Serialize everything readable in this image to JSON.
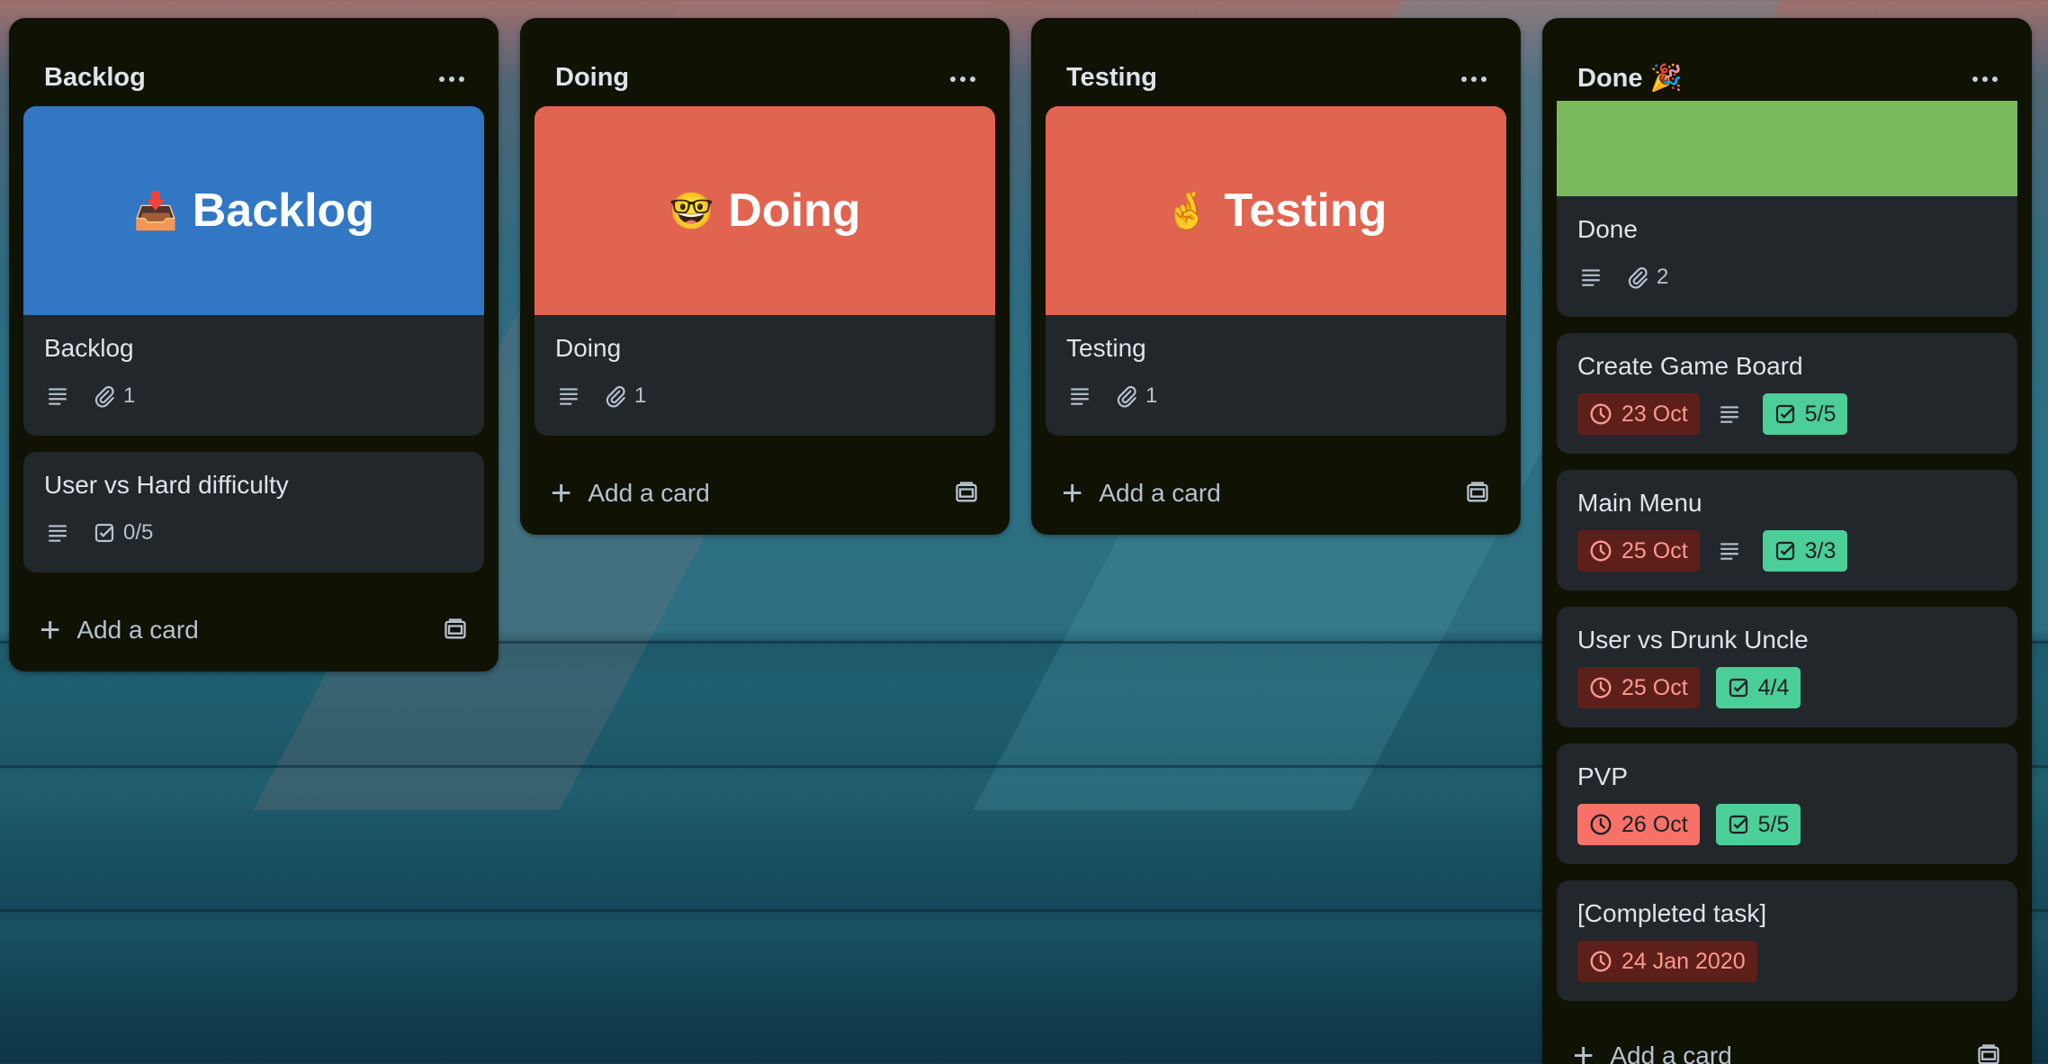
{
  "colors": {
    "list_bg": "#101204",
    "card_bg": "#22272b",
    "cover_blue": "#3177c3",
    "cover_red": "#e06450",
    "cover_green": "#7aba5c",
    "due_red": "#5d1f1a",
    "due_red_strong": "#f87168",
    "checklist_green": "#4bce97"
  },
  "add_card_label": "Add a card",
  "lists": [
    {
      "title": "Backlog",
      "cards": [
        {
          "cover_text": "Backlog",
          "cover_emoji": "📥",
          "title": "Backlog",
          "icons": [
            "description-icon",
            "paperclip-icon"
          ],
          "attachments": "1"
        },
        {
          "title": "User vs Hard difficulty",
          "icons": [
            "description-icon",
            "checklist-icon"
          ],
          "checklist": "0/5"
        }
      ]
    },
    {
      "title": "Doing",
      "cards": [
        {
          "cover_text": "Doing",
          "cover_emoji": "🤓",
          "title": "Doing",
          "icons": [
            "description-icon",
            "paperclip-icon"
          ],
          "attachments": "1"
        }
      ]
    },
    {
      "title": "Testing",
      "cards": [
        {
          "cover_text": "Testing",
          "cover_emoji": "🤞",
          "title": "Testing",
          "icons": [
            "description-icon",
            "paperclip-icon"
          ],
          "attachments": "1"
        }
      ]
    },
    {
      "title": "Done 🎉",
      "cards": [
        {
          "title": "Done",
          "icons": [
            "description-icon",
            "paperclip-icon"
          ],
          "attachments": "2"
        },
        {
          "title": "Create Game Board",
          "due": "23 Oct",
          "has_description": true,
          "checklist": "5/5"
        },
        {
          "title": "Main Menu",
          "due": "25 Oct",
          "has_description": true,
          "checklist": "3/3"
        },
        {
          "title": "User vs Drunk Uncle",
          "due": "25 Oct",
          "checklist": "4/4"
        },
        {
          "title": "PVP",
          "due": "26 Oct",
          "checklist": "5/5"
        },
        {
          "title": "[Completed task]",
          "due": "24 Jan 2020"
        }
      ]
    }
  ]
}
